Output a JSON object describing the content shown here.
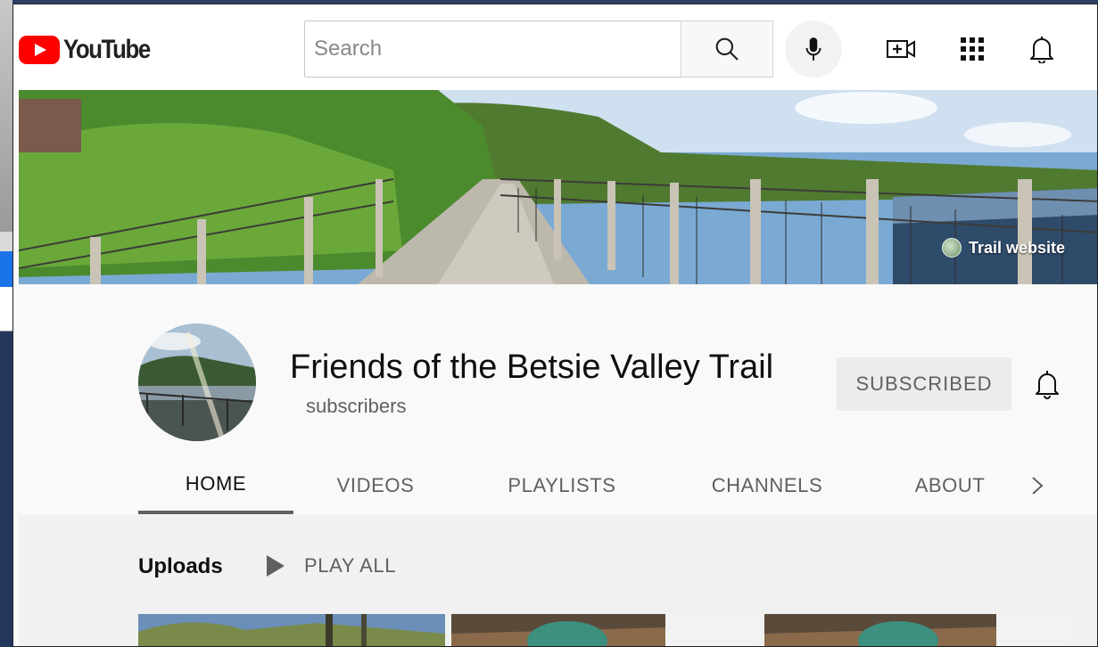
{
  "masthead": {
    "logo_text": "YouTube",
    "search_placeholder": "Search"
  },
  "banner": {
    "link_label": "Trail website"
  },
  "channel": {
    "name": "Friends of the Betsie Valley Trail",
    "subscriber_label": "subscribers",
    "subscribe_label": "SUBSCRIBED"
  },
  "tabs": [
    {
      "label": "HOME",
      "active": true
    },
    {
      "label": "VIDEOS",
      "active": false
    },
    {
      "label": "PLAYLISTS",
      "active": false
    },
    {
      "label": "CHANNELS",
      "active": false
    },
    {
      "label": "ABOUT",
      "active": false
    }
  ],
  "uploads": {
    "title": "Uploads",
    "play_all_label": "PLAY ALL"
  },
  "colors": {
    "brand_red": "#ff0000",
    "text_primary": "#0f0f0f",
    "text_secondary": "#606060"
  }
}
